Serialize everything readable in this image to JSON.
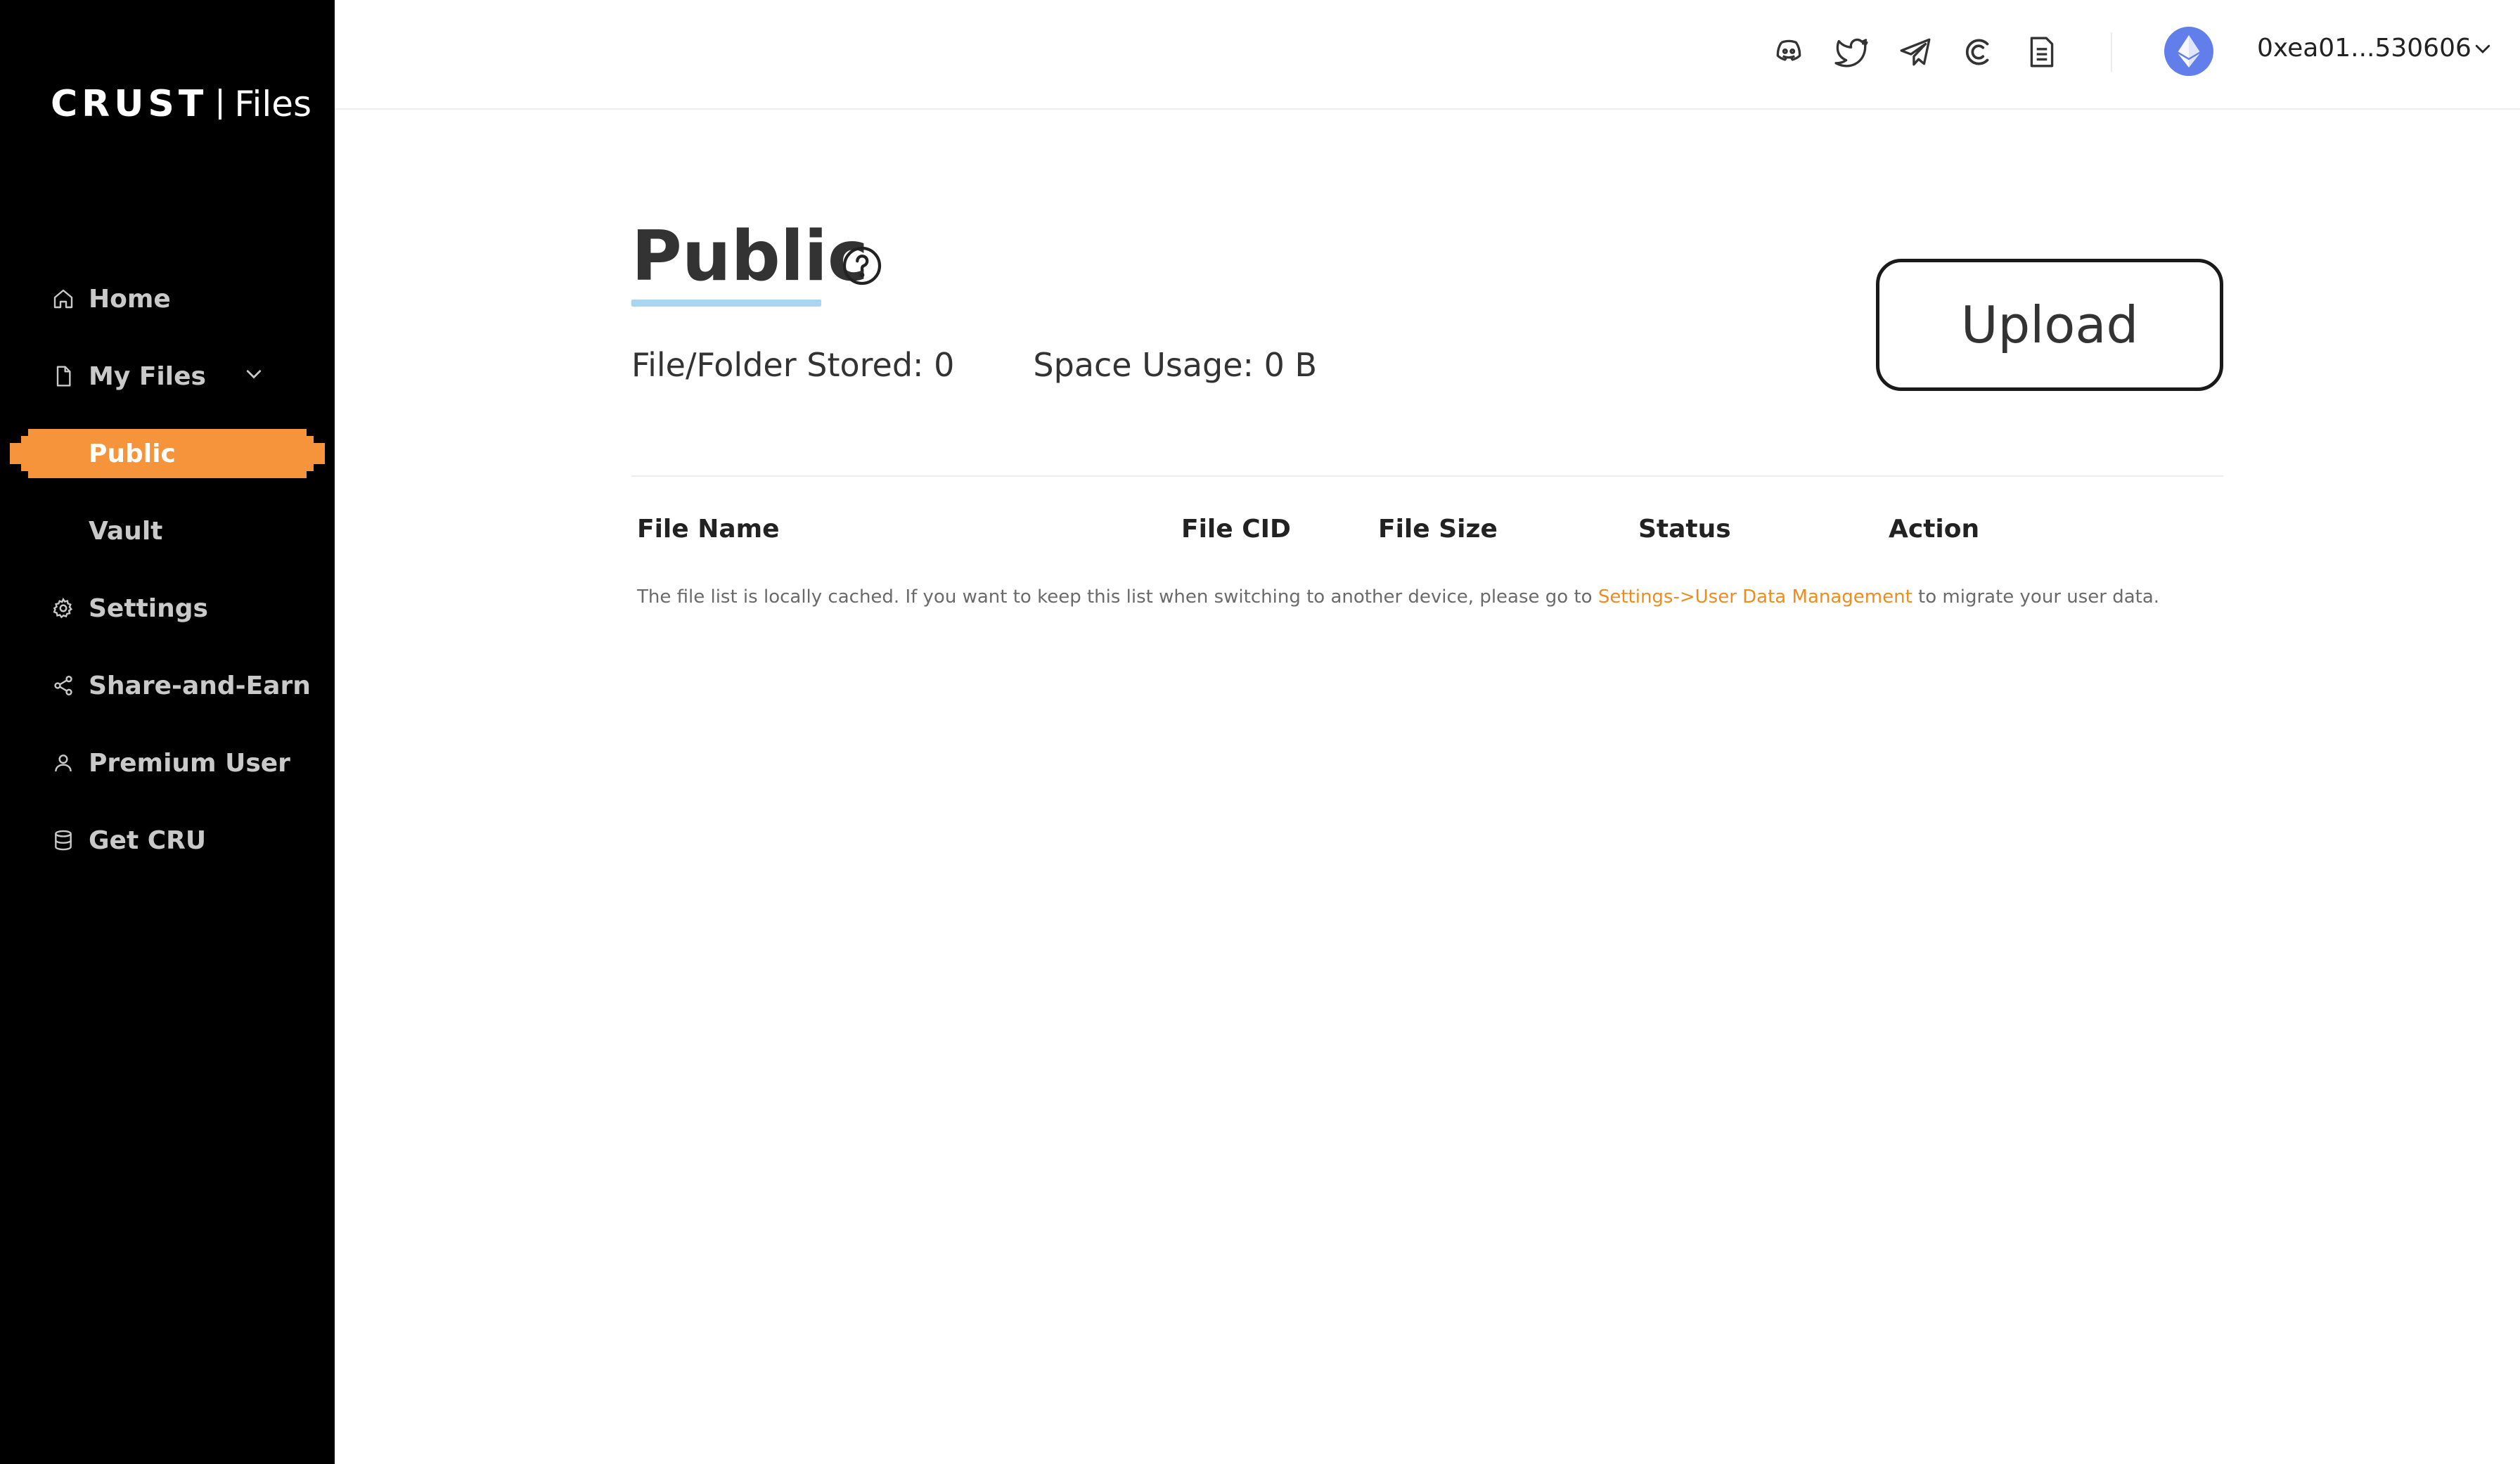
{
  "brand": {
    "logo_main": "CRUST",
    "logo_sub": "Files"
  },
  "sidebar": {
    "items": [
      {
        "label": "Home",
        "icon": "home-icon"
      },
      {
        "label": "My Files",
        "icon": "file-icon"
      },
      {
        "label": "Public",
        "icon": null,
        "active": true
      },
      {
        "label": "Vault",
        "icon": null
      },
      {
        "label": "Settings",
        "icon": "gear-icon"
      },
      {
        "label": "Share-and-Earn",
        "icon": "share-icon"
      },
      {
        "label": "Premium User",
        "icon": "user-icon"
      },
      {
        "label": "Get CRU",
        "icon": "database-icon"
      }
    ],
    "active_color": "#f5943a"
  },
  "header": {
    "icons": [
      "discord-icon",
      "twitter-icon",
      "telegram-icon",
      "crust-icon",
      "document-icon"
    ],
    "account": "0xea01...530606",
    "network_icon": "ethereum-icon"
  },
  "main": {
    "title": "Public",
    "stats": {
      "stored": "File/Folder Stored: 0",
      "usage": "Space Usage: 0 B"
    },
    "upload_label": "Upload",
    "table": {
      "columns": [
        "File Name",
        "File CID",
        "File Size",
        "Status",
        "Action"
      ]
    },
    "note": {
      "prefix": "The file list is locally cached. If you want to keep this list when switching to another device, please go to ",
      "link": "Settings->User Data Management",
      "suffix": " to migrate your user data."
    }
  },
  "colors": {
    "sidebar_bg": "#000000",
    "accent": "#f5943a",
    "link": "#f08c1e",
    "title_underline": "#a6d6f0"
  }
}
